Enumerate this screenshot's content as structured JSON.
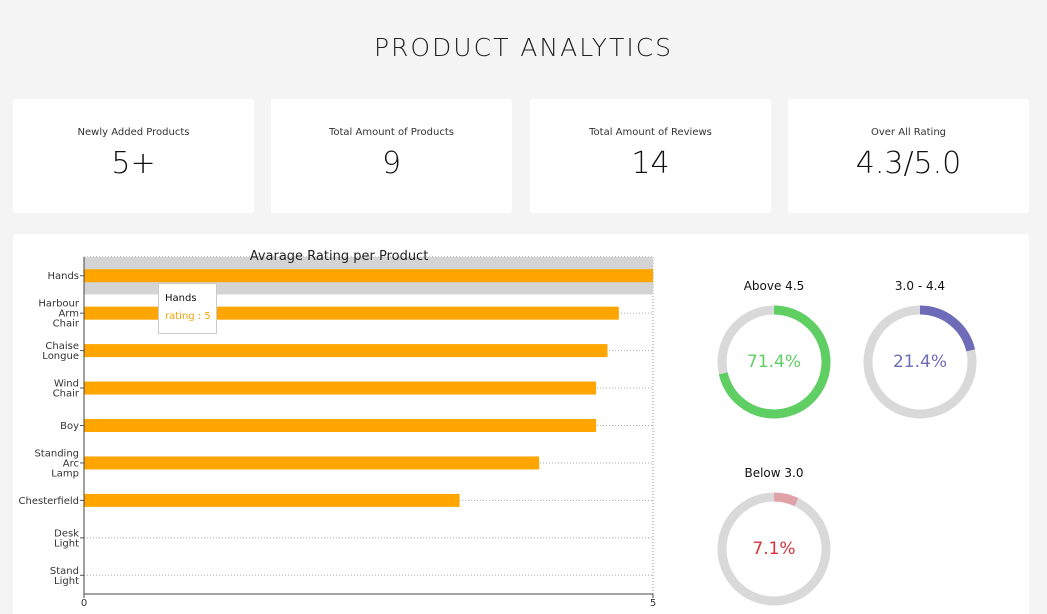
{
  "header": {
    "title": "PRODUCT ANALYTICS"
  },
  "stats": [
    {
      "label": "Newly Added Products",
      "value": "5+"
    },
    {
      "label": "Total Amount of Products",
      "value": "9"
    },
    {
      "label": "Total Amount of Reviews",
      "value": "14"
    },
    {
      "label": "Over All Rating",
      "value": "4.3/5.0"
    }
  ],
  "colors": {
    "bar": "#ffa500",
    "highlight": "#d4d4d4",
    "ring_track": "#d9d9d9"
  },
  "chart_data": [
    {
      "type": "bar",
      "orientation": "horizontal",
      "title": "Avarage Rating per Product",
      "categories": [
        [
          "Hands"
        ],
        [
          "Harbour",
          "Arm",
          "Chair"
        ],
        [
          "Chaise",
          "Longue"
        ],
        [
          "Wind",
          "Chair"
        ],
        [
          "Boy"
        ],
        [
          "Standing",
          "Arc",
          "Lamp"
        ],
        [
          "Chesterfield"
        ],
        [
          "Desk",
          "Light"
        ],
        [
          "Stand",
          "Light"
        ]
      ],
      "values": [
        5,
        4.7,
        4.6,
        4.5,
        4.5,
        4,
        3.3,
        0,
        0
      ],
      "xlim": [
        0,
        5
      ],
      "xticks": [
        "0",
        "5"
      ],
      "highlighted": "Hands",
      "tooltip": {
        "label": "Hands",
        "value_text": "rating : 5"
      }
    },
    {
      "type": "pie",
      "style": "donut",
      "title": "Above 4.5",
      "value": 71.4,
      "display": "71.4%",
      "color": "#5fcf64"
    },
    {
      "type": "pie",
      "style": "donut",
      "title": "3.0 - 4.4",
      "value": 21.4,
      "display": "21.4%",
      "color": "#6e6cb8"
    },
    {
      "type": "pie",
      "style": "donut",
      "title": "Below 3.0",
      "value": 7.1,
      "display": "7.1%",
      "color": "#e0a2a8",
      "text_color": "#d6333a"
    }
  ]
}
